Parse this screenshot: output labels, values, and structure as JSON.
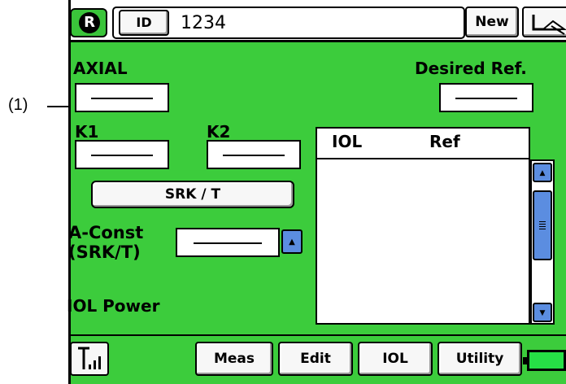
{
  "callout": {
    "label": "(1)"
  },
  "header": {
    "r_logo": "R",
    "id_label": "ID",
    "id_value": "1234",
    "new_label": "New"
  },
  "main": {
    "axial_label": "AXIAL",
    "desired_ref_label": "Desired Ref.",
    "k1_label": "K1",
    "k2_label": "K2",
    "formula_button": "SRK / T",
    "aconst_label_line1": "A-Const",
    "aconst_label_line2": "(SRK/T)",
    "iol_power_label": "IOL Power",
    "list_columns": [
      "IOL",
      "Ref"
    ]
  },
  "footer": {
    "buttons": [
      "Meas",
      "Edit",
      "IOL",
      "Utility"
    ]
  },
  "colors": {
    "background": "#3ccc3c",
    "scroll_arrow": "#5b8de0",
    "battery": "#26e046"
  }
}
